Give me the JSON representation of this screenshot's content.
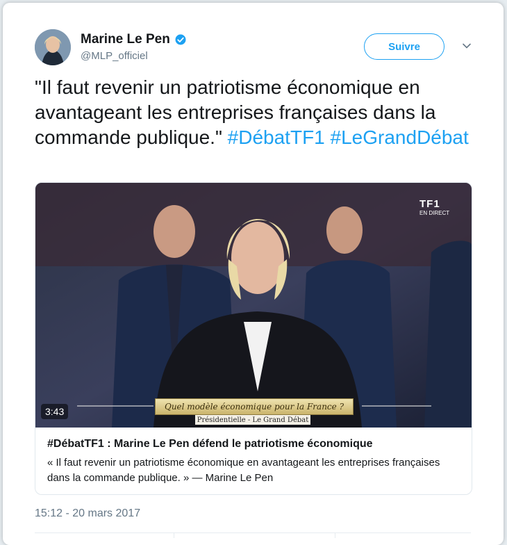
{
  "tweet": {
    "author_name": "Marine Le Pen",
    "author_handle": "@MLP_officiel",
    "follow_label": "Suivre",
    "text": "\"Il faut revenir un patriotisme économique en avantageant les entreprises françaises dans la commande publique.\"",
    "hashtags": [
      "#DébatTF1",
      "#LeGrandDébat"
    ],
    "timestamp": "15:12 - 20 mars 2017"
  },
  "media_card": {
    "duration": "3:43",
    "overlay_title": "Quel modèle économique pour la France ?",
    "overlay_subtitle": "Présidentielle - Le Grand Débat",
    "channel_logo": "TF1",
    "channel_live": "EN DIRECT",
    "title": "#DébatTF1 : Marine Le Pen défend le patriotisme économique",
    "description": "« Il faut revenir un patriotisme économique en avantageant les entreprises françaises dans la commande publique. » — Marine Le Pen"
  },
  "icons": {
    "verified": "verified-badge-icon",
    "caret": "chevron-down-icon"
  },
  "colors": {
    "accent": "#1da1f2",
    "text": "#14171a",
    "muted": "#657786"
  }
}
